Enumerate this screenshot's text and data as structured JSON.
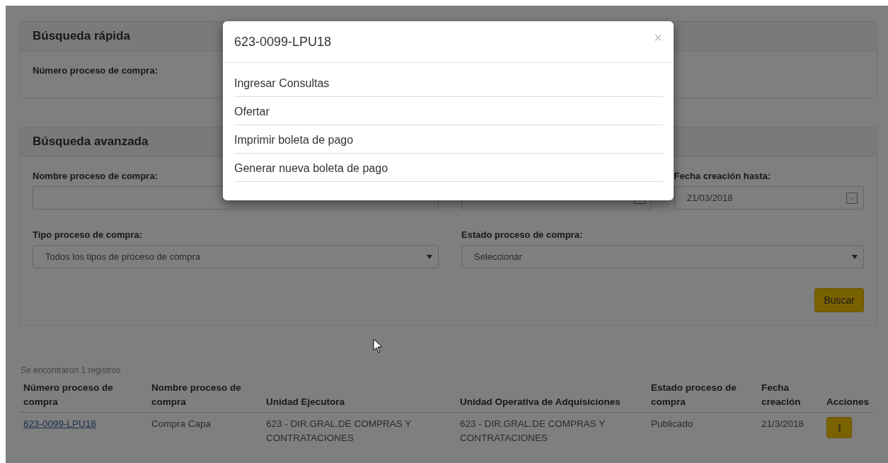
{
  "quick_search": {
    "title": "Búsqueda rápida",
    "field_label": "Número proceso de compra:"
  },
  "advanced_search": {
    "title": "Búsqueda avanzada",
    "name_label": "Nombre proceso de compra:",
    "date_to_label": "Fecha creación hasta:",
    "date_to_value": "21/03/2018",
    "type_label": "Tipo proceso de compra:",
    "type_value": "Todos los tipos de proceso de compra",
    "status_label": "Estado proceso de compra:",
    "status_value": "Seleccionar",
    "search_button": "Buscar"
  },
  "results": {
    "summary": "Se encontraron 1 registros",
    "columns": [
      "Número proceso de compra",
      "Nombre proceso de compra",
      "Unidad Ejecutora",
      "Unidad Operativa de Adquisiciones",
      "Estado proceso de compra",
      "Fecha creación",
      "Acciones"
    ],
    "rows": [
      {
        "number": "623-0099-LPU18",
        "name": "Compra Capa",
        "executing_unit": "623 - DIR.GRAL.DE COMPRAS Y CONTRATACIONES",
        "procurement_unit": "623 - DIR.GRAL.DE COMPRAS Y CONTRATACIONES",
        "status": "Publicado",
        "created": "21/3/2018"
      }
    ]
  },
  "modal": {
    "title": "623-0099-LPU18",
    "close": "×",
    "items": [
      "Ingresar Consultas",
      "Ofertar",
      "Imprimir boleta de pago",
      "Generar nueva boleta de pago"
    ]
  }
}
